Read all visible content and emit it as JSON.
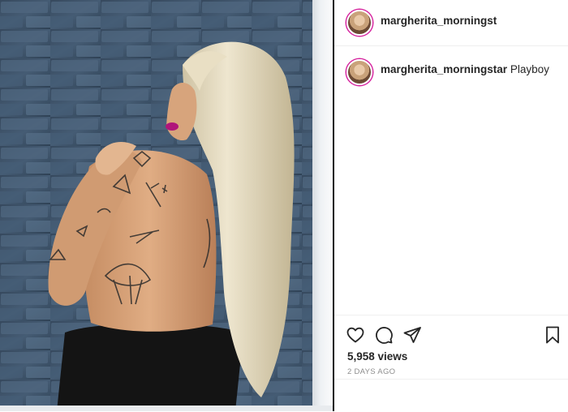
{
  "header": {
    "username": "margherita_morningst"
  },
  "caption": {
    "username": "margherita_morningstar",
    "text": "Playboy"
  },
  "stats": {
    "views": "5,958 views",
    "time_ago": "2 DAYS AGO"
  },
  "icons": {
    "like": "heart-icon",
    "comment": "comment-icon",
    "share": "share-icon",
    "save": "bookmark-icon"
  },
  "colors": {
    "story_ring": "#d6249f",
    "secondary_text": "#8e8e8e"
  }
}
